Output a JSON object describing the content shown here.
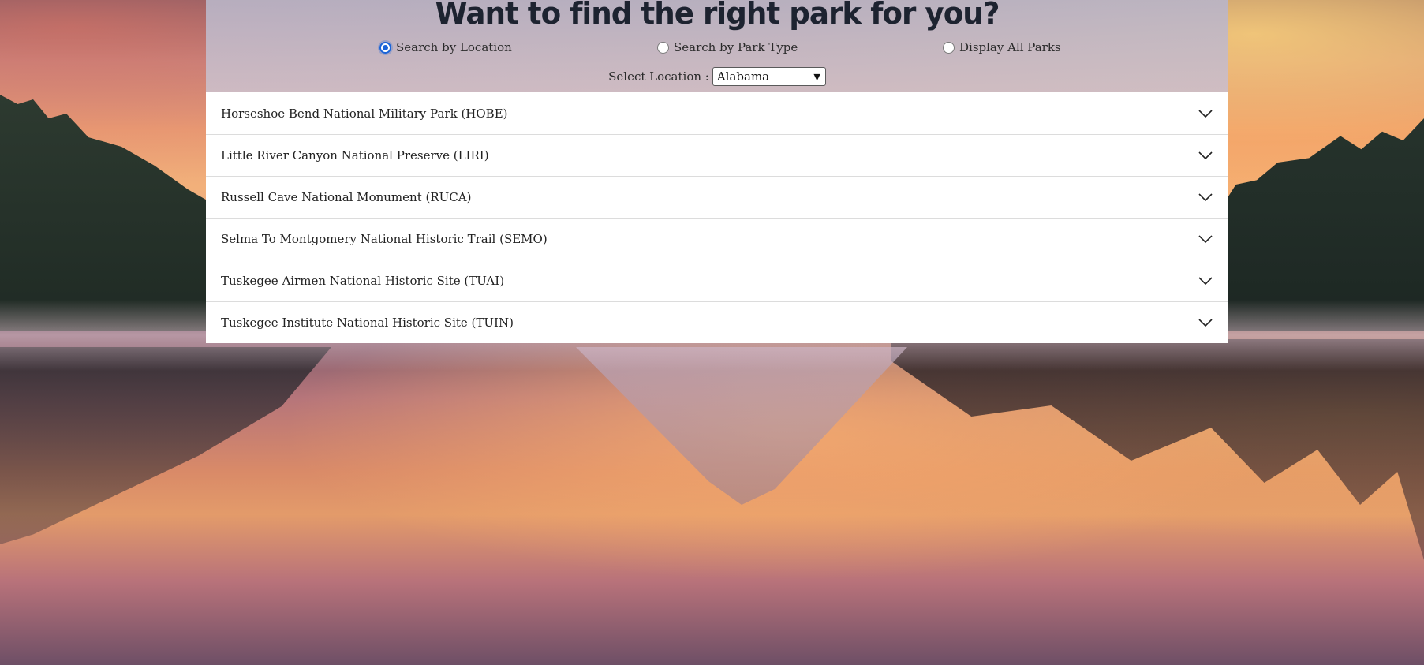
{
  "header": {
    "title": "Want to find the right park for you?"
  },
  "search_modes": [
    {
      "label": "Search by Location",
      "checked": true
    },
    {
      "label": "Search by Park Type",
      "checked": false
    },
    {
      "label": "Display All Parks",
      "checked": false
    }
  ],
  "location_filter": {
    "label": "Select Location :",
    "selected": "Alabama"
  },
  "parks": [
    {
      "name": "Horseshoe Bend National Military Park (HOBE)"
    },
    {
      "name": "Little River Canyon National Preserve (LIRI)"
    },
    {
      "name": "Russell Cave National Monument (RUCA)"
    },
    {
      "name": "Selma To Montgomery National Historic Trail (SEMO)"
    },
    {
      "name": "Tuskegee Airmen National Historic Site (TUAI)"
    },
    {
      "name": "Tuskegee Institute National Historic Site (TUIN)"
    }
  ],
  "icons": {
    "expand": "chevron-down-icon"
  },
  "colors": {
    "accent": "#1a64d8",
    "title": "#1d2330"
  }
}
